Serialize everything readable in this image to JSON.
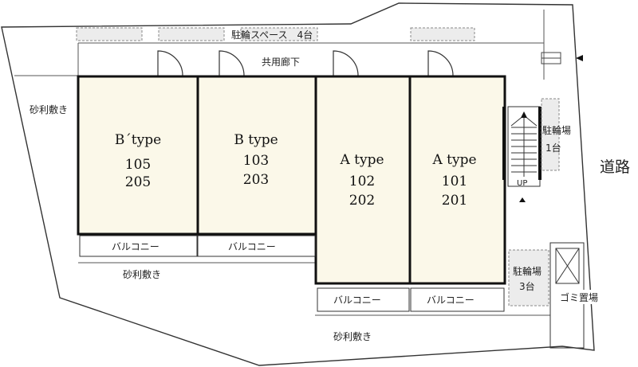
{
  "colors": {
    "unit_fill": "#fbf8e9",
    "parking_fill": "#ececec",
    "outline": "#111111",
    "thin_line": "#555555"
  },
  "labels": {
    "bike_space_top": "駐輪スペース　4台",
    "corridor": "共用廊下",
    "gravel_left": "砂利敷き",
    "gravel_mid": "砂利敷き",
    "gravel_bottom": "砂利敷き",
    "road": "道路",
    "bike_right_line1": "駐輪場",
    "bike_right_line2": "1台",
    "bike_lower_line1": "駐輪場",
    "bike_lower_line2": "3台",
    "garbage": "ゴミ置場",
    "stairs_up": "UP"
  },
  "units": [
    {
      "type": "B´type",
      "line1": "105",
      "line2": "205"
    },
    {
      "type": "B type",
      "line1": "103",
      "line2": "203"
    },
    {
      "type": "A type",
      "line1": "102",
      "line2": "202"
    },
    {
      "type": "A type",
      "line1": "101",
      "line2": "201"
    }
  ],
  "balconies": [
    "バルコニー",
    "バルコニー",
    "バルコニー",
    "バルコニー"
  ]
}
